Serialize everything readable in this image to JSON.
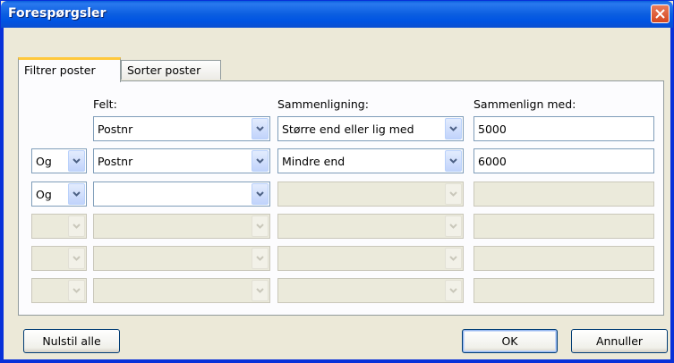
{
  "window": {
    "title": "Forespørgsler"
  },
  "tabs": [
    {
      "label": "Filtrer poster",
      "selected": true
    },
    {
      "label": "Sorter poster",
      "selected": false
    }
  ],
  "headers": {
    "field": "Felt:",
    "comparison": "Sammenligning:",
    "compare_with": "Sammenlign med:"
  },
  "rows": [
    {
      "connector": "",
      "field": "Postnr",
      "comparison": "Større end eller lig med",
      "value": "5000"
    },
    {
      "connector": "Og",
      "field": "Postnr",
      "comparison": "Mindre end",
      "value": "6000"
    },
    {
      "connector": "Og",
      "field": "",
      "comparison": "",
      "value": ""
    },
    {
      "connector": "",
      "field": "",
      "comparison": "",
      "value": ""
    },
    {
      "connector": "",
      "field": "",
      "comparison": "",
      "value": ""
    },
    {
      "connector": "",
      "field": "",
      "comparison": "",
      "value": ""
    }
  ],
  "buttons": {
    "reset": "Nulstil alle",
    "ok": "OK",
    "cancel": "Annuller"
  },
  "colors": {
    "titlebar": "#0054e3",
    "close": "#d5471f",
    "dialog_bg": "#ece9d8",
    "tab_highlight": "#ffc83c",
    "input_border": "#7f9db9"
  },
  "icons": {
    "close": "close-icon",
    "dropdown": "chevron-down-icon"
  }
}
